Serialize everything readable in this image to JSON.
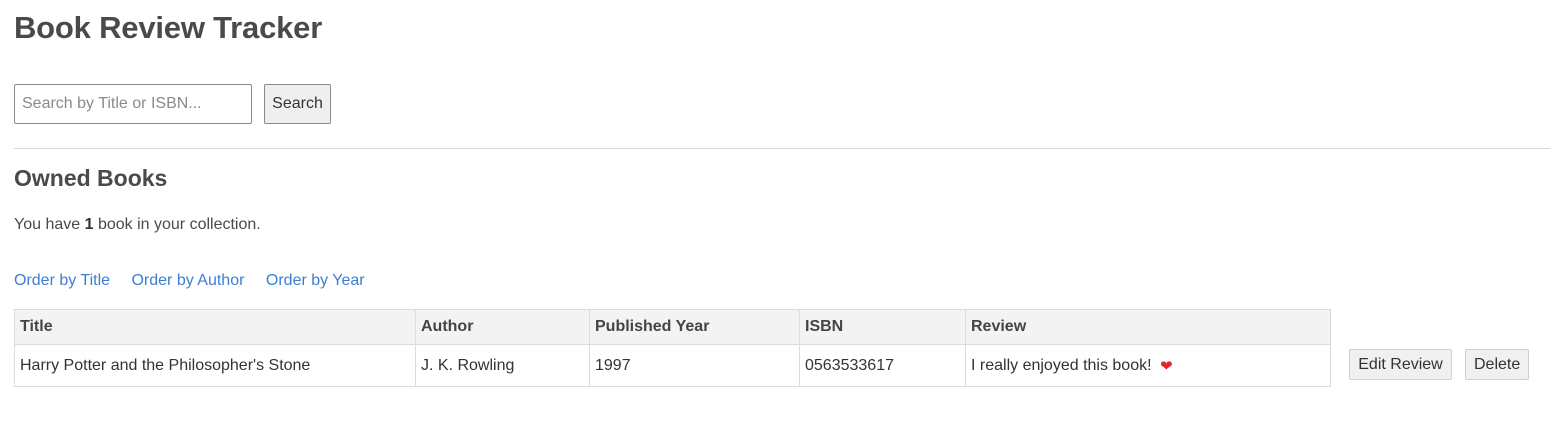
{
  "header": {
    "title": "Book Review Tracker"
  },
  "search": {
    "placeholder": "Search by Title or ISBN...",
    "value": "",
    "button_label": "Search"
  },
  "owned": {
    "heading": "Owned Books",
    "count_prefix": "You have",
    "count": "1",
    "count_suffix": "book in your collection."
  },
  "order_links": [
    {
      "label": "Order by Title"
    },
    {
      "label": "Order by Author"
    },
    {
      "label": "Order by Year"
    }
  ],
  "table": {
    "columns": [
      "Title",
      "Author",
      "Published Year",
      "ISBN",
      "Review"
    ],
    "rows": [
      {
        "title": "Harry Potter and the Philosopher's Stone",
        "author": "J. K. Rowling",
        "year": "1997",
        "isbn": "0563533617",
        "review": "I really enjoyed this book!",
        "review_icon": "heart-icon"
      }
    ]
  },
  "row_actions": {
    "edit_label": "Edit Review",
    "delete_label": "Delete"
  },
  "colors": {
    "link": "#3b7fd4",
    "heart": "#e0262f",
    "header_bg": "#f3f3f3"
  }
}
